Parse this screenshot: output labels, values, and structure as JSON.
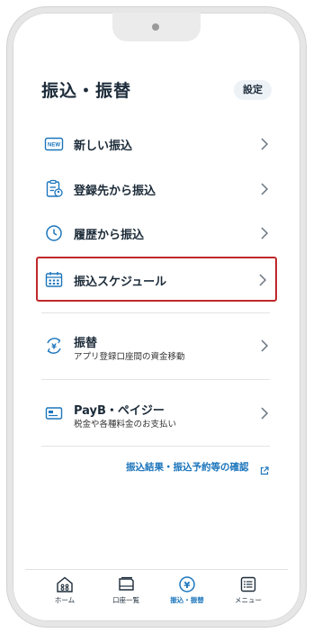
{
  "header": {
    "title": "振込・振替",
    "settings_label": "設定"
  },
  "menu": [
    {
      "label": "新しい振込",
      "icon": "new-badge-icon",
      "new_badge": "NEW"
    },
    {
      "label": "登録先から振込",
      "icon": "clipboard-user-icon"
    },
    {
      "label": "履歴から振込",
      "icon": "clock-icon"
    },
    {
      "label": "振込スケジュール",
      "icon": "calendar-icon",
      "selected": true
    },
    {
      "label": "振替",
      "sub": "アプリ登録口座間の資金移動",
      "icon": "yen-transfer-icon"
    },
    {
      "label": "PayB・ペイジー",
      "sub": "税金や各種料金のお支払い",
      "icon": "card-icon"
    }
  ],
  "link": {
    "label": "振込結果・振込予約等の確認",
    "icon": "external-link-icon"
  },
  "tabs": [
    {
      "label": "ホーム",
      "icon": "home-icon"
    },
    {
      "label": "口座一覧",
      "icon": "passbook-icon"
    },
    {
      "label": "振込・振替",
      "icon": "yen-circle-icon",
      "active": true
    },
    {
      "label": "メニュー",
      "icon": "menu-list-icon"
    }
  ],
  "colors": {
    "accent": "#1b75bc",
    "selected_border": "#c0282b",
    "text": "#1c2b39"
  }
}
